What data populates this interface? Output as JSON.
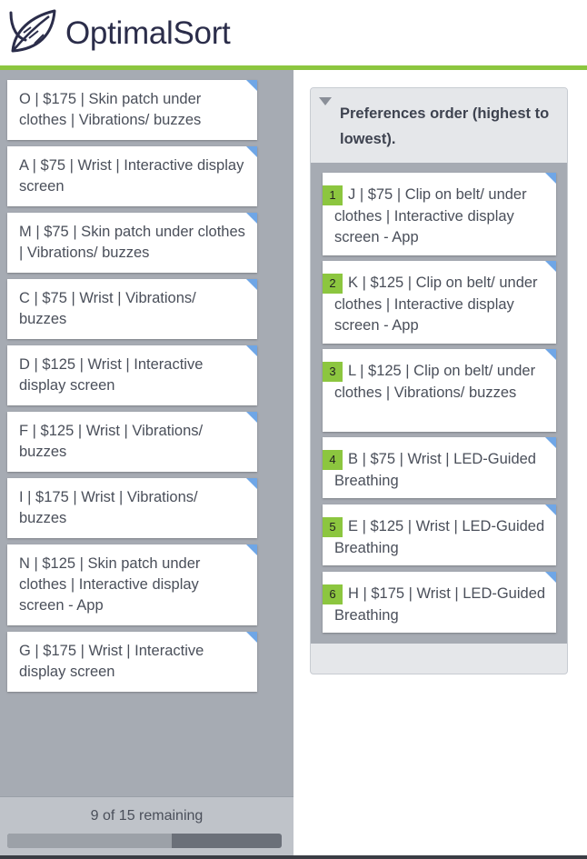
{
  "brand": {
    "name": "OptimalSort",
    "accent": "#8cc63f"
  },
  "unsorted_cards": [
    {
      "label": "O | $175 | Skin patch under clothes | Vibrations/ buzzes"
    },
    {
      "label": "A | $75 | Wrist | Interactive display screen"
    },
    {
      "label": "M | $75 | Skin patch under clothes | Vibrations/ buzzes"
    },
    {
      "label": "C | $75 | Wrist | Vibrations/ buzzes"
    },
    {
      "label": "D | $125 | Wrist | Interactive display screen"
    },
    {
      "label": "F | $125 | Wrist | Vibrations/ buzzes"
    },
    {
      "label": "I | $175 | Wrist | Vibrations/ buzzes"
    },
    {
      "label": "N | $125 | Skin patch under clothes | Interactive display screen - App"
    },
    {
      "label": "G | $175 | Wrist | Interactive display screen"
    }
  ],
  "progress": {
    "text": "9 of 15 remaining",
    "fraction": 0.6
  },
  "category": {
    "title": "Preferences order (highest to lowest).",
    "cards": [
      {
        "num": "1",
        "label": "J | $75 | Clip on belt/ under clothes | Interactive display screen - App"
      },
      {
        "num": "2",
        "label": "K | $125 | Clip on belt/ under clothes | Interactive display screen - App"
      },
      {
        "num": "3",
        "label": "L | $125 | Clip on belt/ under clothes | Vibrations/ buzzes"
      },
      {
        "num": "4",
        "label": "B | $75 | Wrist | LED-Guided Breathing"
      },
      {
        "num": "5",
        "label": "E | $125 | Wrist | LED-Guided Breathing"
      },
      {
        "num": "6",
        "label": "H | $175 | Wrist | LED-Guided Breathing"
      }
    ]
  },
  "icons": {
    "logo": "leaf-icon",
    "collapse": "triangle-down-icon",
    "card_corner": "corner-marker-icon"
  }
}
